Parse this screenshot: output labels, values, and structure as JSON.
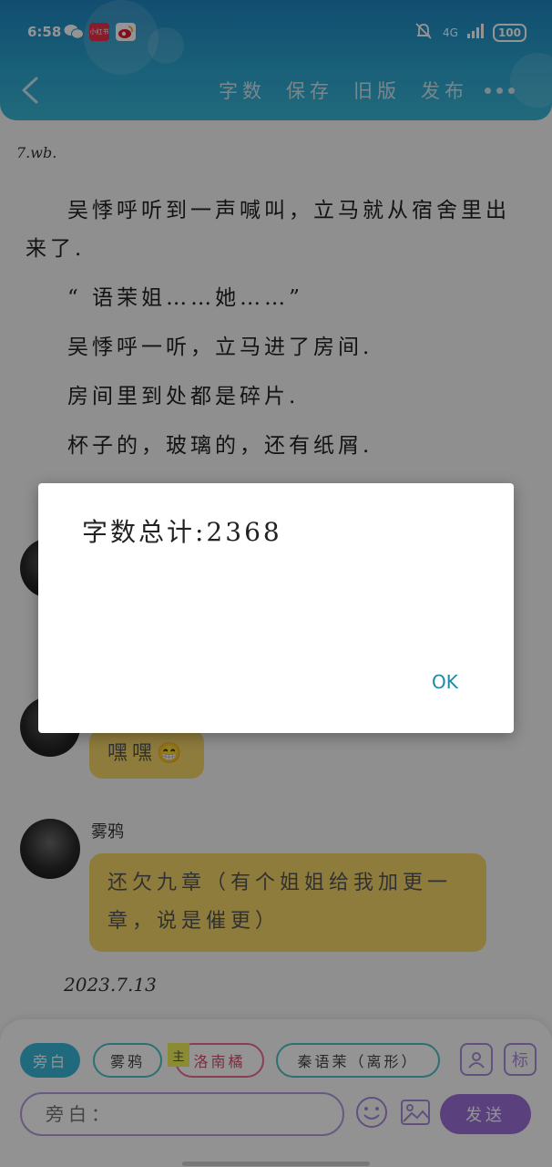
{
  "status_bar": {
    "time": "6:58",
    "network": "4G",
    "battery": "100",
    "app_icons": [
      "wechat-icon",
      "xiaohongshu-icon",
      "weibo-icon"
    ],
    "xiaohongshu_label": "小红书"
  },
  "header": {
    "nav_items": [
      "字数",
      "保存",
      "旧版",
      "发布"
    ],
    "gradient_colors": [
      "#1f86c1",
      "#3bb6d6"
    ]
  },
  "story": {
    "meta_tag": "7.wb.",
    "paragraphs": [
      "吴悸呼听到一声喊叫，立马就从宿舍里出来了.",
      "“ 语茉姐……她……”",
      "吴悸呼一听，立马进了房间.",
      "房间里到处都是碎片.",
      "杯子的，玻璃的，还有纸屑."
    ]
  },
  "chat": {
    "messages": [
      {
        "sender": "",
        "text": "嘿嘿😁"
      },
      {
        "sender": "雾鸦",
        "text": "还欠九章（有个姐姐给我加更一章，说是催更）"
      }
    ],
    "date": "2023.7.13",
    "bubble_color": "#f5d66a"
  },
  "composer": {
    "chips": [
      {
        "label": "旁白",
        "style": "active"
      },
      {
        "label": "雾鸦",
        "style": "teal"
      },
      {
        "label": "洛南橘",
        "style": "pink"
      },
      {
        "label": "秦语茉（离形）",
        "style": "teal"
      }
    ],
    "host_badge": "主",
    "marker_button": "标",
    "input_placeholder": "旁白：",
    "send_label": "发送",
    "accent_color": "#9b6fd8"
  },
  "dialog": {
    "message": "字数总计:2368",
    "ok_label": "OK"
  }
}
